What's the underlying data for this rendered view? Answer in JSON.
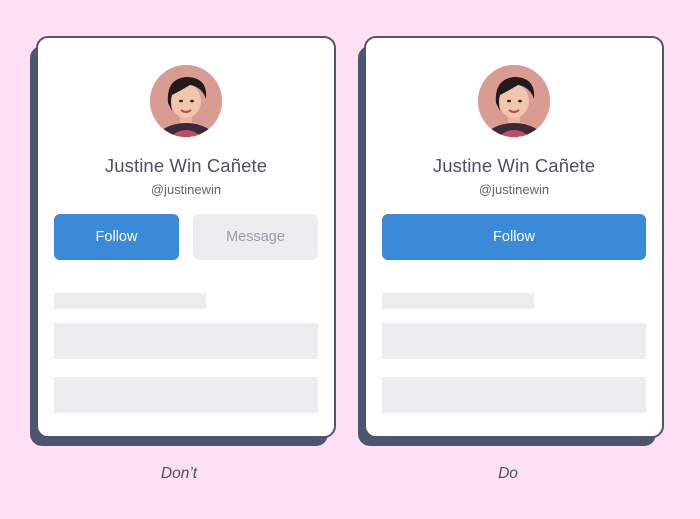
{
  "profile": {
    "name": "Justine Win Cañete",
    "handle": "@justinewin"
  },
  "dont_card": {
    "follow_label": "Follow",
    "message_label": "Message"
  },
  "do_card": {
    "follow_label": "Follow"
  },
  "captions": {
    "dont": "Don’t",
    "do": "Do"
  },
  "colors": {
    "background": "#fde0f3",
    "card_border": "#4e5570",
    "primary_button": "#3b8ad9",
    "secondary_button": "#ededf0",
    "placeholder": "#ededf0"
  },
  "icons": {
    "avatar": "profile-photo"
  }
}
